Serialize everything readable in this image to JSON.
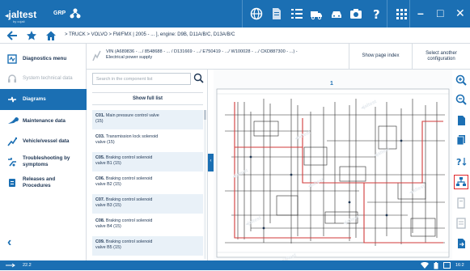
{
  "app": {
    "brand": "jaltest",
    "brand_sub": "by cojali",
    "module": "GRP"
  },
  "topbar": {
    "icons": [
      "globe-icon",
      "document-icon",
      "list-icon",
      "truck-icon",
      "car-icon",
      "camera-icon",
      "help-icon",
      "apps-icon"
    ],
    "window_buttons": {
      "minimize": "–",
      "maximize": "□",
      "close": "✕"
    }
  },
  "navbar": {
    "breadcrumb": "> TRUCK > VOLVO > FM/FMX | 2005 - ... ], engine: D9B, D11A/B/C, D13A/B/C"
  },
  "sidebar": {
    "items": [
      {
        "label": "Diagnostics menu",
        "icon": "diagnostics-icon",
        "state": "normal"
      },
      {
        "label": "System technical data",
        "icon": "headset-icon",
        "state": "disabled"
      },
      {
        "label": "Diagrams",
        "icon": "diagram-icon",
        "state": "active"
      },
      {
        "label": "Maintenance data",
        "icon": "wrench-icon",
        "state": "normal"
      },
      {
        "label": "Vehicle/vessel data",
        "icon": "vehicle-data-icon",
        "state": "normal"
      },
      {
        "label": "Troubleshooting by symptoms",
        "icon": "troubleshoot-icon",
        "state": "normal"
      },
      {
        "label": "Releases and Procedures",
        "icon": "procedures-icon",
        "state": "normal"
      }
    ],
    "back": "‹"
  },
  "vinbar": {
    "line1": "VIN (A689836 - .../ 8548688 - ... / D131669 - .../ E750419 - .../ W100028 - .../ CKD887300 - ...) -",
    "line2": "Electrical power supply",
    "show_page_index": "Show page index",
    "select_config": "Select another configuration"
  },
  "list": {
    "search_placeholder": "Search in the component list",
    "show_full": "Show full list",
    "items": [
      {
        "code": "C01.",
        "name": "Main pressure control valve",
        "extra": "(15)"
      },
      {
        "code": "C03.",
        "name": "Transmission lock solenoid",
        "extra": "valve (15)"
      },
      {
        "code": "C05.",
        "name": "Braking control solenoid",
        "extra": "valve B1 (15)"
      },
      {
        "code": "C06.",
        "name": "Braking control solenoid",
        "extra": "valve B2 (15)"
      },
      {
        "code": "C07.",
        "name": "Braking control solenoid",
        "extra": "valve B3 (15)"
      },
      {
        "code": "C08.",
        "name": "Braking control solenoid",
        "extra": "valve B4 (15)"
      },
      {
        "code": "C09.",
        "name": "Braking control solenoid",
        "extra": "valve B5 (15)"
      }
    ]
  },
  "diagram": {
    "page_number": "1",
    "collapse": "‹"
  },
  "right_tools": [
    "zoom-in-icon",
    "zoom-out-icon",
    "page-icon",
    "pages-icon",
    "sort-icon",
    "component-tree-icon",
    "layers-icon",
    "legend-icon",
    "export-icon"
  ],
  "status": {
    "version": "22.2",
    "time": "16:2"
  },
  "colors": {
    "primary": "#1b6fb3",
    "selected_outline": "#e0262b",
    "wire_red": "#d23a3a"
  }
}
